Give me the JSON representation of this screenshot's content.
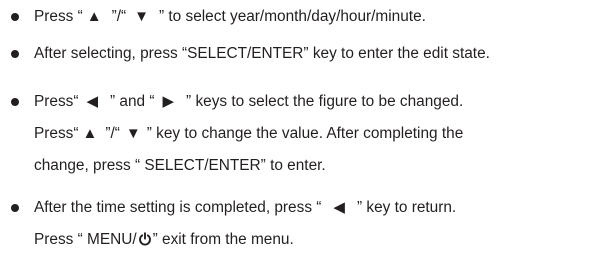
{
  "instructions": {
    "item1": {
      "line1": {
        "a": "Press “",
        "b": "”/“",
        "c": "” to select year/month/day/hour/minute."
      }
    },
    "item2": {
      "line1": {
        "a": "After selecting, press “SELECT/ENTER” key to enter the edit state."
      }
    },
    "item3": {
      "line1": {
        "a": "Press“",
        "b": "” and “",
        "c": "” keys to select the figure to be changed."
      },
      "line2": {
        "a": "Press“",
        "b": "”/“",
        "c": "” key to change the value. After completing the"
      },
      "line3": {
        "a": "change, press “ SELECT/ENTER” to enter."
      }
    },
    "item4": {
      "line1": {
        "a": "After the time setting is completed, press “",
        "b": "” key to return."
      },
      "line2": {
        "a": "Press “ MENU/",
        "b": "” exit from the menu."
      }
    }
  },
  "glyphs": {
    "up": "▲",
    "down": "▼",
    "left": "◀",
    "right": "▶"
  },
  "icons": [
    "up-arrow-icon",
    "down-arrow-icon",
    "left-arrow-icon",
    "right-arrow-icon",
    "power-icon"
  ]
}
